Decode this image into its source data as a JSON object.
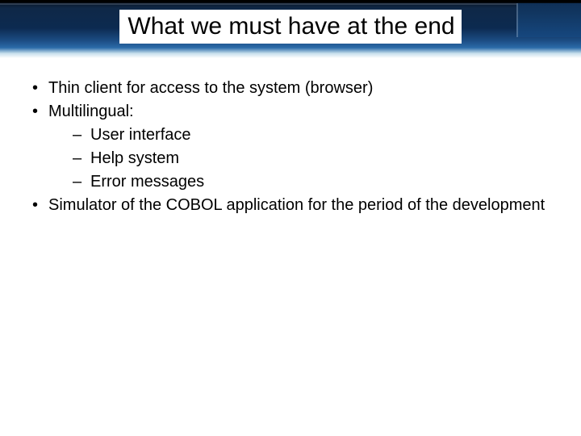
{
  "title": "What we must have at the end",
  "bullets": [
    {
      "text": "Thin client for access to the system (browser)"
    },
    {
      "text": "Multilingual:",
      "sub": [
        "User interface",
        "Help system",
        "Error messages"
      ]
    },
    {
      "text": "Simulator of the COBOL application for the period of the development"
    }
  ]
}
